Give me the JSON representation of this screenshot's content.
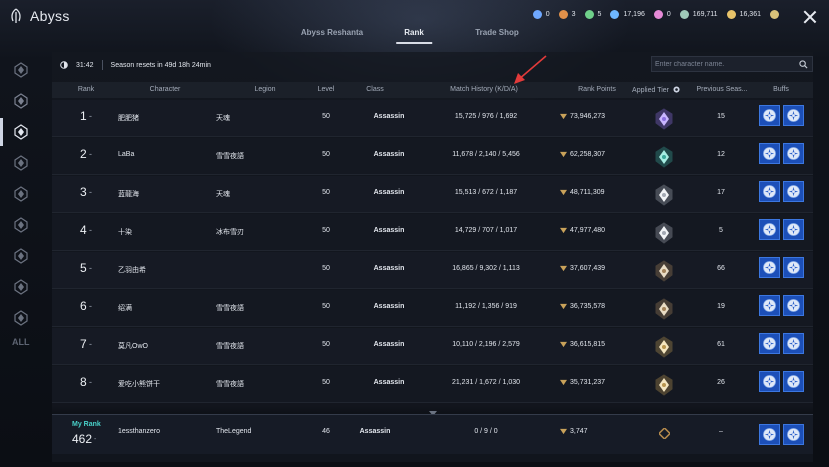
{
  "app": {
    "title": "Abyss"
  },
  "tabs": [
    {
      "label": "Abyss Reshanta",
      "active": false
    },
    {
      "label": "Rank",
      "active": true
    },
    {
      "label": "Trade Shop",
      "active": false
    }
  ],
  "currencies": [
    {
      "icon": "blue-quill-icon",
      "value": "0",
      "color": "#6fa8ff"
    },
    {
      "icon": "orange-quill-icon",
      "value": "3",
      "color": "#e0904a"
    },
    {
      "icon": "green-quill-icon",
      "value": "5",
      "color": "#6fd08a"
    },
    {
      "icon": "abyss-point-icon",
      "value": "17,196",
      "color": "#6fb7ff"
    },
    {
      "icon": "pink-gem-icon",
      "value": "0",
      "color": "#e58ad6"
    },
    {
      "icon": "medal-icon",
      "value": "169,711",
      "color": "#9fc9b8"
    },
    {
      "icon": "kinah-coin-icon",
      "value": "16,361",
      "color": "#e8c36a"
    },
    {
      "icon": "gift-icon",
      "value": "",
      "color": "#d9c27a"
    }
  ],
  "season": {
    "timer": "31:42",
    "reset_text": "Season resets in 49d 18h 24min"
  },
  "search": {
    "placeholder": "Enter character name."
  },
  "columns": {
    "rank": "Rank",
    "character": "Character",
    "legion": "Legion",
    "level": "Level",
    "class": "Class",
    "match_history": "Match History (K/D/A)",
    "rank_points": "Rank Points",
    "applied_tier": "Applied Tier",
    "previous_season": "Previous Seas...",
    "buffs": "Buffs"
  },
  "rows": [
    {
      "rank": "1",
      "dash": "-",
      "character": "肥肥猪",
      "legion": "天魂",
      "level": "50",
      "class": "Assassin",
      "kda": "15,725 / 976 / 1,692",
      "points": "73,946,273",
      "tier": "tier-purple-icon",
      "prev": "15"
    },
    {
      "rank": "2",
      "dash": "-",
      "character": "LaBa",
      "legion": "雪雪夜語",
      "level": "50",
      "class": "Assassin",
      "kda": "11,678 / 2,140 / 5,456",
      "points": "62,258,307",
      "tier": "tier-teal-icon",
      "prev": "12"
    },
    {
      "rank": "3",
      "dash": "-",
      "character": "蓝龍海",
      "legion": "天魂",
      "level": "50",
      "class": "Assassin",
      "kda": "15,513 / 672 / 1,187",
      "points": "48,711,309",
      "tier": "tier-silver-wing-icon",
      "prev": "17"
    },
    {
      "rank": "4",
      "dash": "-",
      "character": "十染",
      "legion": "冰布雪刃",
      "level": "50",
      "class": "Assassin",
      "kda": "14,729 / 707 / 1,017",
      "points": "47,977,480",
      "tier": "tier-silver-wing-icon",
      "prev": "5"
    },
    {
      "rank": "5",
      "dash": "-",
      "character": "乙羽由希",
      "legion": "",
      "level": "50",
      "class": "Assassin",
      "kda": "16,865 / 9,302 / 1,113",
      "points": "37,607,439",
      "tier": "tier-bronze-wing-icon",
      "prev": "66"
    },
    {
      "rank": "6",
      "dash": "-",
      "character": "绍满",
      "legion": "雪雪夜語",
      "level": "50",
      "class": "Assassin",
      "kda": "11,192 / 1,356 / 919",
      "points": "36,735,578",
      "tier": "tier-bronze-wing-icon",
      "prev": "19"
    },
    {
      "rank": "7",
      "dash": "-",
      "character": "莫凡OwO",
      "legion": "雪雪夜語",
      "level": "50",
      "class": "Assassin",
      "kda": "10,110 / 2,196 / 2,579",
      "points": "36,615,815",
      "tier": "tier-gold-star-icon",
      "prev": "61"
    },
    {
      "rank": "8",
      "dash": "-",
      "character": "爱吃小熊饼干",
      "legion": "雪雪夜語",
      "level": "50",
      "class": "Assassin",
      "kda": "21,231 / 1,672 / 1,030",
      "points": "35,731,237",
      "tier": "tier-gold-star-icon",
      "prev": "26"
    }
  ],
  "my_rank": {
    "label": "My Rank",
    "rank": "462",
    "dash": "-",
    "character": "1essthanzero",
    "legion": "TheLegend",
    "level": "46",
    "class": "Assassin",
    "kda": "0 / 9 / 0",
    "points": "3,747",
    "tier": "tier-bronze-diamond-icon",
    "prev": "–"
  },
  "sidebar": {
    "items": [
      "tier-1-icon",
      "tier-2-icon",
      "tier-3-icon",
      "tier-4-icon",
      "tier-5-icon",
      "tier-6-icon",
      "tier-7-icon",
      "tier-8-icon",
      "tier-9-icon"
    ],
    "all_label": "ALL"
  },
  "colors": {
    "accent_teal": "#49d1c9",
    "buff_blue": "#1c4fb8",
    "annotation_red": "#e23a3a"
  }
}
